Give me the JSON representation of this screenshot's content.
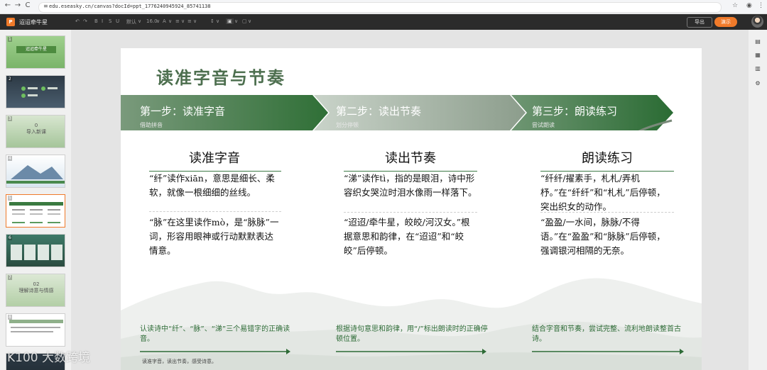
{
  "browser": {
    "url": "edu.eseasky.cn/canvas?docId=ppt_1776240945924_85741138",
    "back_icon": "←",
    "forward_icon": "→",
    "reload_icon": "C",
    "home_icon": "⌂",
    "lock_icon": "≡",
    "star_icon": "☆",
    "profile_icon": "◉",
    "menu_icon": "⋮"
  },
  "app": {
    "logo": "P",
    "doc_title": "迢迢牵牛星",
    "toolbar_items": [
      "↶",
      "↷",
      "B",
      "I",
      "S",
      "U",
      "默认",
      "∨",
      "16.0",
      "∨",
      "A",
      "∨",
      "≡",
      "∨",
      "≡",
      "∨",
      "↕",
      "∨",
      "▣",
      "∨",
      "▢",
      "∨"
    ],
    "export_label": "导出",
    "play_label": "演示"
  },
  "thumbnails": {
    "slides": [
      {
        "num": "1",
        "title": "迢迢牵牛星"
      },
      {
        "num": "2",
        "title": ""
      },
      {
        "num": "3",
        "title": "导入新课"
      },
      {
        "num": "4",
        "title": ""
      },
      {
        "num": "5",
        "title": ""
      },
      {
        "num": "6",
        "title": ""
      },
      {
        "num": "7",
        "title": "理解诗意与情感"
      },
      {
        "num": "8",
        "title": ""
      },
      {
        "num": "9",
        "title": ""
      }
    ],
    "slide3_number": "0",
    "slide7_number": "02"
  },
  "right_panel": {
    "icons": [
      "▤",
      "▦",
      "▥",
      "⚙"
    ]
  },
  "slide": {
    "title": "读准字音与节奏",
    "steps": [
      {
        "label": "第一步：读准字音",
        "sub": "借助拼音"
      },
      {
        "label": "第二步：读出节奏",
        "sub": "划分停顿"
      },
      {
        "label": "第三步：朗读练习",
        "sub": "尝试朗读"
      }
    ],
    "columns": [
      {
        "heading": "读准字音",
        "para1": "“纤”读作xiān，意思是细长、柔软，就像一根细细的丝线。",
        "para2": "“脉”在这里读作mò，是“脉脉”一词，形容用眼神或行动默默表达情意。",
        "summary": "认读诗中“纤”、“脉”、“涕”三个易错字的正确读音。"
      },
      {
        "heading": "读出节奏",
        "para1": "“涕”读作tì，指的是眼泪，诗中形容织女哭泣时泪水像雨一样落下。",
        "para2": "“迢迢/牵牛星，皎皎/河汉女。”根据意思和韵律，在“迢迢”和“皎皎”后停顿。",
        "summary": "根据诗句意思和韵律，用“/”标出朗读时的正确停顿位置。"
      },
      {
        "heading": "朗读练习",
        "para1": "“纤纤/擢素手，札札/弄机杼。”在“纤纤”和“札札”后停顿，突出织女的动作。",
        "para2": "“盈盈/一水间，脉脉/不得语。”在“盈盈”和“脉脉”后停顿，强调银河相隔的无奈。",
        "summary": "结合字音和节奏，尝试完整、流利地朗读整首古诗。"
      }
    ],
    "footnote": "读准字音，读出节奏，感受诗意。"
  },
  "watermark": "K100 大数跨境",
  "colors": {
    "band_dark": "#2e6e35",
    "band_light": "#a8b5a8",
    "accent": "#f07a2a",
    "summary_text": "#2d6b36"
  }
}
